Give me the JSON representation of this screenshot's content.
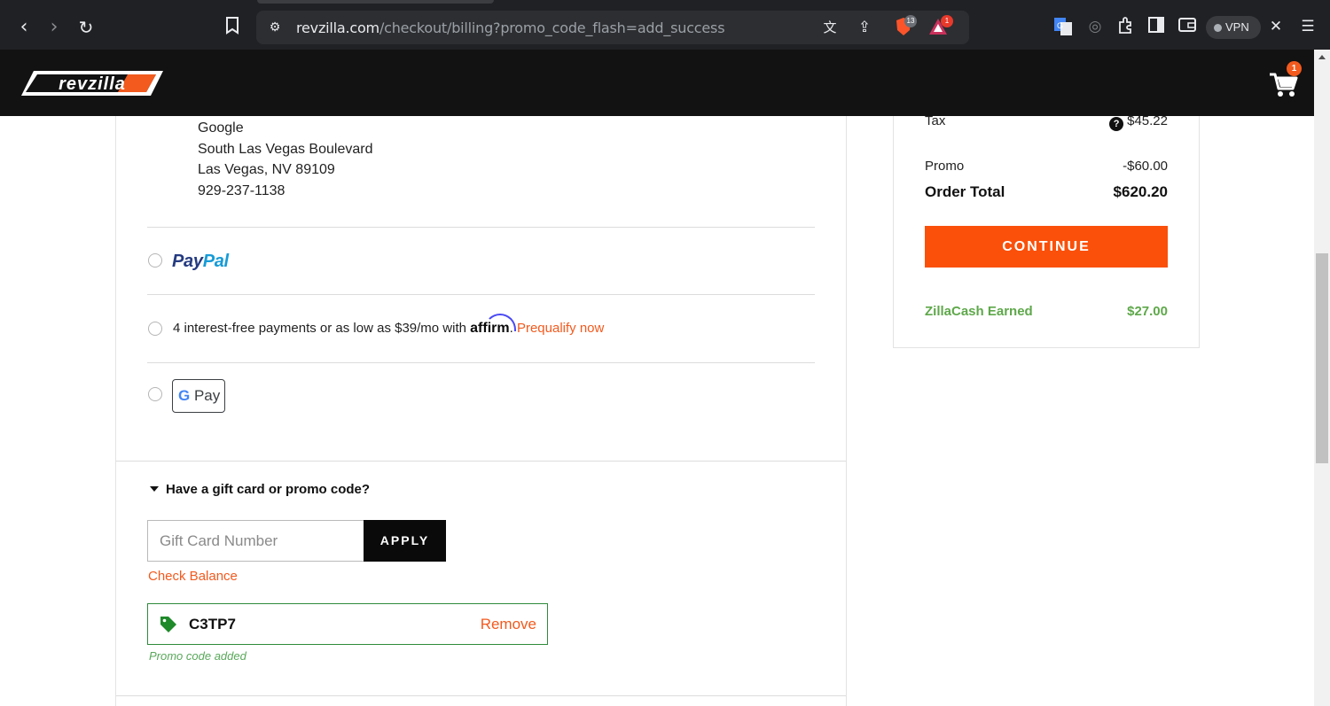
{
  "browser": {
    "url_host": "revzilla.com",
    "url_path": "/checkout/billing?promo_code_flash=add_success",
    "brave_badge": "13",
    "rewards_badge": "1",
    "vpn_label": "VPN"
  },
  "header": {
    "logo_text": "revzilla",
    "cart_count": "1"
  },
  "shipping_address": {
    "name": "Google",
    "street": "South Las Vegas Boulevard",
    "city_state_zip": "Las Vegas, NV 89109",
    "phone": "929-237-1138"
  },
  "payment_options": {
    "paypal_pay": "Pay",
    "paypal_pal": "Pal",
    "affirm_text": "4 interest-free payments or as low as $39/mo with",
    "affirm_brand": "affirm",
    "affirm_period": ".",
    "affirm_link": "Prequalify now",
    "gpay_g": "G",
    "gpay_label": "Pay"
  },
  "promo": {
    "toggle_label": "Have a gift card or promo code?",
    "input_placeholder": "Gift Card Number",
    "apply_label": "APPLY",
    "check_balance": "Check Balance",
    "applied_code": "C3TP7",
    "remove_label": "Remove",
    "status": "Promo code added"
  },
  "summary": {
    "tax_label": "Tax",
    "tax_value": "$45.22",
    "promo_label": "Promo",
    "promo_value": "-$60.00",
    "total_label": "Order Total",
    "total_value": "$620.20",
    "continue_label": "CONTINUE",
    "zillacash_label": "ZillaCash Earned",
    "zillacash_value": "$27.00"
  },
  "colors": {
    "accent_orange": "#fa500a",
    "link_orange": "#f25a1e",
    "success_green": "#2e8b3a",
    "header_black": "#121212"
  }
}
